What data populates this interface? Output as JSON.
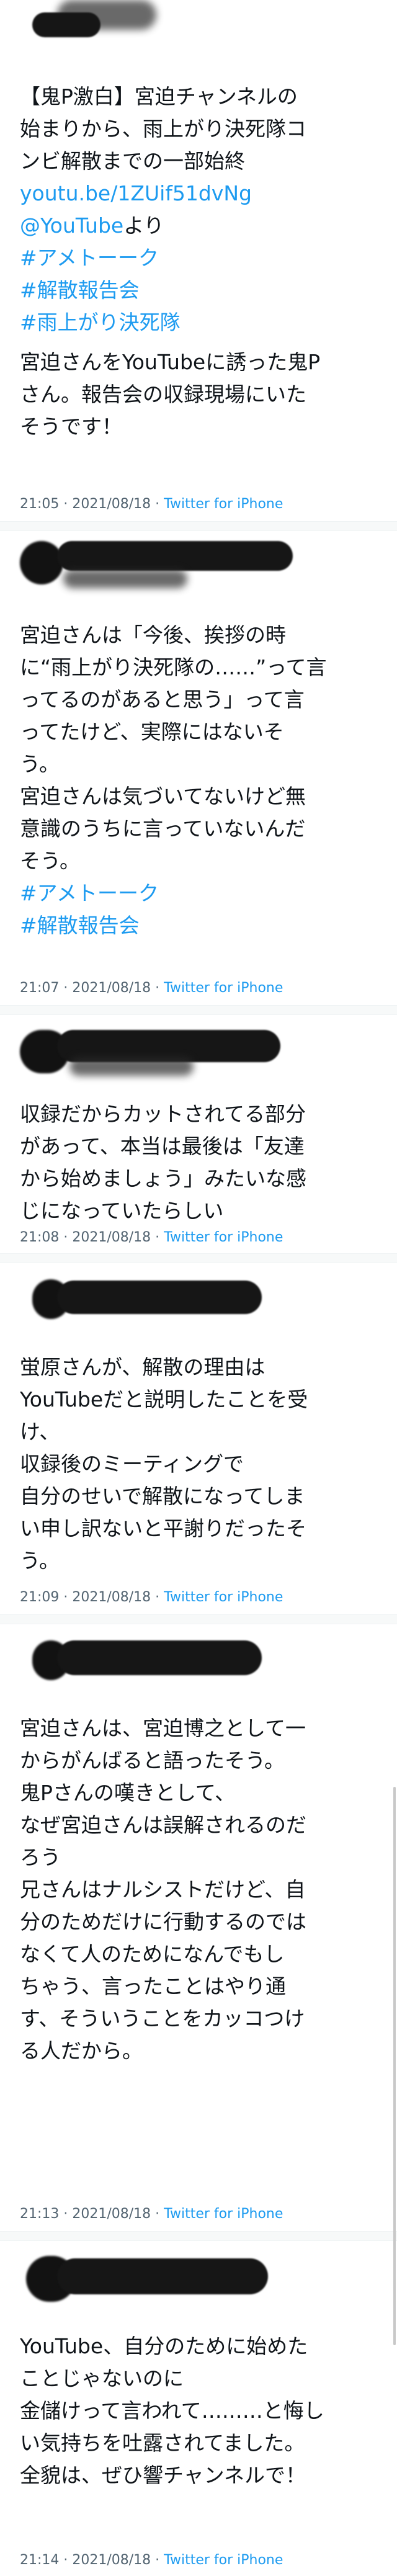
{
  "tweets": [
    {
      "lines_before_links": "【鬼P激白】宮迫チャンネルの\n始まりから、雨上がり決死隊コ\nンビ解散までの一部始終",
      "url": "youtu.be/1ZUif51dvNg",
      "mention": "@YouTube",
      "mention_suffix": "より",
      "hashtags": [
        "#アメトーーク",
        "#解散報告会",
        "#雨上がり決死隊"
      ],
      "text_after": "宮迫さんをYouTubeに誘った鬼P\nさん。報告会の収録現場にいた\nそうです！",
      "time": "21:05 · 2021/08/18 · ",
      "source": "Twitter for iPhone"
    },
    {
      "text": "宮迫さんは「今後、挨拶の時\nに“雨上がり決死隊の……”って言\nってるのがあると思う」って言\nってたけど、実際にはないそ\nう。\n宮迫さんは気づいてないけど無\n意識のうちに言っていないんだ\nそう。",
      "hashtags": [
        "#アメトーーク",
        "#解散報告会"
      ],
      "time": "21:07 · 2021/08/18 · ",
      "source": "Twitter for iPhone"
    },
    {
      "text": "収録だからカットされてる部分\nがあって、本当は最後は「友達\nから始めましょう」みたいな感\nじになっていたらしい",
      "time": "21:08 · 2021/08/18 · ",
      "source": "Twitter for iPhone"
    },
    {
      "text": "蛍原さんが、解散の理由は\nYouTubeだと説明したことを受\nけ、\n収録後のミーティングで\n自分のせいで解散になってしま\nい申し訳ないと平謝りだったそ\nう。",
      "time": "21:09 · 2021/08/18 · ",
      "source": "Twitter for iPhone"
    },
    {
      "text": "宮迫さんは、宮迫博之として一\nからがんばると語ったそう。\n鬼Pさんの嘆きとして、\nなぜ宮迫さんは誤解されるのだ\nろう\n兄さんはナルシストだけど、自\n分のためだけに行動するのでは\nなくて人のためになんでもし\nちゃう、言ったことはやり通\nす、そういうことをカッコつけ\nる人だから。",
      "time": "21:13 · 2021/08/18 · ",
      "source": "Twitter for iPhone"
    },
    {
      "text": "YouTube、自分のために始めた\nことじゃないのに\n金儲けって言われて………と悔し\nい気持ちを吐露されてました。\n全貌は、ぜひ響チャンネルで！",
      "time": "21:14 · 2021/08/18 · ",
      "source": "Twitter for iPhone"
    }
  ]
}
